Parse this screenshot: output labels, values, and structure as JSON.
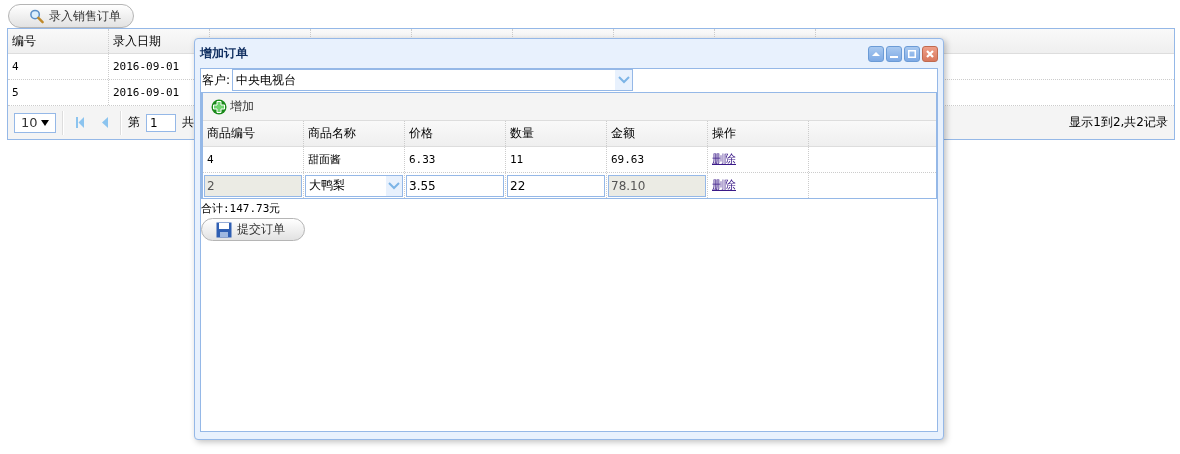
{
  "toolbar_button": {
    "label": "录入销售订单"
  },
  "orders_table": {
    "columns": [
      "编号",
      "录入日期"
    ],
    "rows": [
      {
        "cells": [
          "4",
          "2016-09-01"
        ]
      },
      {
        "cells": [
          "5",
          "2016-09-01"
        ]
      }
    ]
  },
  "pager": {
    "page_size": "10",
    "page_label": "第",
    "page": "1",
    "of_label": "共",
    "summary": "显示1到2,共2记录"
  },
  "dialog": {
    "title": "增加订单",
    "customer_label": "客户:",
    "customer": "中央电视台",
    "add_button": "增加",
    "columns": [
      "商品编号",
      "商品名称",
      "价格",
      "数量",
      "金额",
      "操作"
    ],
    "rows": [
      {
        "cells": [
          {
            "kind": "text",
            "value": "4"
          },
          {
            "kind": "text",
            "value": "甜面酱"
          },
          {
            "kind": "text",
            "value": "6.33"
          },
          {
            "kind": "text",
            "value": "11"
          },
          {
            "kind": "text",
            "value": "69.63"
          }
        ],
        "action": "删除"
      },
      {
        "cells": [
          {
            "kind": "readonly",
            "value": "2"
          },
          {
            "kind": "combo",
            "value": "大鸭梨"
          },
          {
            "kind": "input",
            "value": "3.55"
          },
          {
            "kind": "input",
            "value": "22"
          },
          {
            "kind": "readonly",
            "value": "78.10"
          }
        ],
        "action": "删除"
      }
    ],
    "total": "合计:147.73元",
    "submit_button": "提交订单"
  }
}
